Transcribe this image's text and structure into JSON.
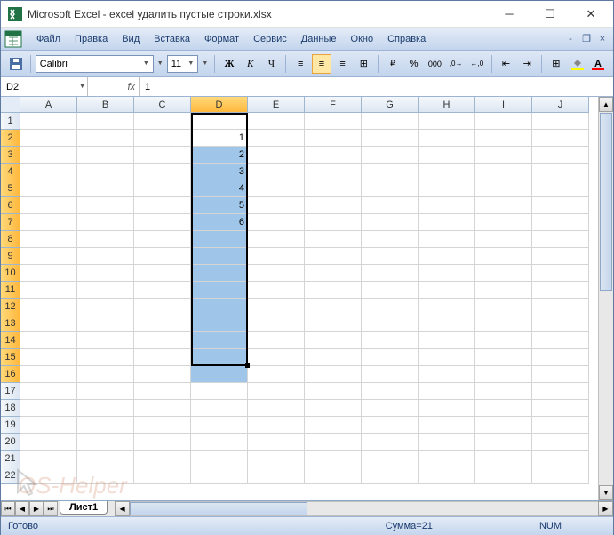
{
  "title": "Microsoft Excel - excel удалить пустые строки.xlsx",
  "menu": [
    "Файл",
    "Правка",
    "Вид",
    "Вставка",
    "Формат",
    "Сервис",
    "Данные",
    "Окно",
    "Справка"
  ],
  "toolbar": {
    "font_name": "Calibri",
    "font_size": "11"
  },
  "name_box": "D2",
  "fx_label": "fx",
  "formula_value": "1",
  "columns": [
    "A",
    "B",
    "C",
    "D",
    "E",
    "F",
    "G",
    "H",
    "I",
    "J"
  ],
  "selected_column": "D",
  "rows_visible": 22,
  "selected_rows": [
    2,
    3,
    4,
    5,
    6,
    7,
    8,
    9,
    10,
    11,
    12,
    13,
    14,
    15,
    16
  ],
  "active_cell": "D2",
  "selection": {
    "col": "D",
    "row_start": 2,
    "row_end": 16
  },
  "cell_data": {
    "D2": "1",
    "D3": "2",
    "D4": "3",
    "D5": "4",
    "D6": "5",
    "D7": "6"
  },
  "sheet_tab": "Лист1",
  "status": {
    "ready": "Готово",
    "sum": "Сумма=21",
    "num": "NUM"
  },
  "watermark": "OS-Helper"
}
